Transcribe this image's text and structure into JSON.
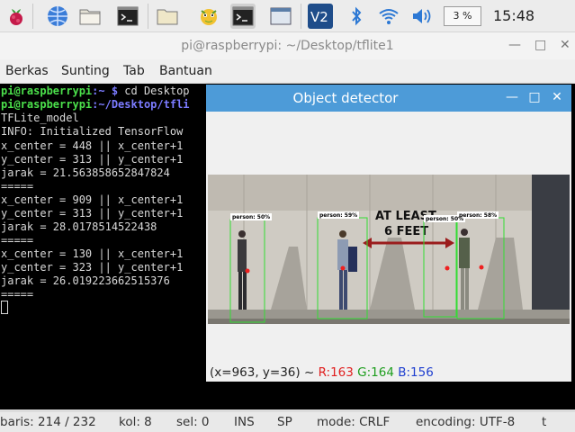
{
  "taskbar": {
    "cpu": "3 %",
    "clock": "15:48",
    "icons": [
      "raspberry-menu-icon",
      "web-browser-icon",
      "file-manager-icon",
      "terminal-icon",
      "file-manager-window-icon",
      "object-detector-window-icon",
      "terminal-window-icon",
      "generic-window-icon",
      "vnc-icon",
      "bluetooth-icon",
      "wifi-icon",
      "volume-icon"
    ]
  },
  "terminal": {
    "title": "pi@raspberrypi: ~/Desktop/tflite1",
    "menu": [
      "Berkas",
      "Sunting",
      "Tab",
      "Bantuan"
    ],
    "prompt1_user": "pi@raspberrypi",
    "prompt1_path": ":~ $",
    "prompt1_cmd": " cd Desktop",
    "prompt2_user": "pi@raspberrypi",
    "prompt2_path": ":~/Desktop/tfli",
    "lines": [
      "TFLite_model",
      "INFO: Initialized TensorFlow",
      "x_center = 448 || x_center+1",
      "y_center = 313 || y_center+1",
      "jarak = 21.563858652847824",
      "=====",
      "x_center = 909 || x_center+1",
      "y_center = 313 || y_center+1",
      "jarak = 28.0178514522438",
      "=====",
      "x_center = 130 || x_center+1",
      "y_center = 323 || y_center+1",
      "jarak = 26.019223662515376",
      "====="
    ],
    "status": {
      "line": "baris: 214 / 232",
      "col": "kol: 8",
      "sel": "sel: 0",
      "ins": "INS",
      "sp": "SP",
      "mode": "mode: CRLF",
      "encoding": "encoding: UTF-8",
      "tail": "t"
    }
  },
  "detector": {
    "title": "Object detector",
    "detections": [
      {
        "label": "person: 50%"
      },
      {
        "label": "person: 59%"
      },
      {
        "label": "person: 50%"
      },
      {
        "label": "person: 58%"
      }
    ],
    "sign_line1": "AT LEAST",
    "sign_line2": "6 FEET",
    "pixel_info_prefix": "(x=963, y=36) ~ ",
    "r": "R:163",
    "g": "G:164",
    "b": "B:156"
  },
  "colors": {
    "titlebar_accent": "#4d9bd8",
    "detection_box": "#33dd33",
    "prompt_user": "#4be04b",
    "prompt_path": "#7b7bff"
  }
}
